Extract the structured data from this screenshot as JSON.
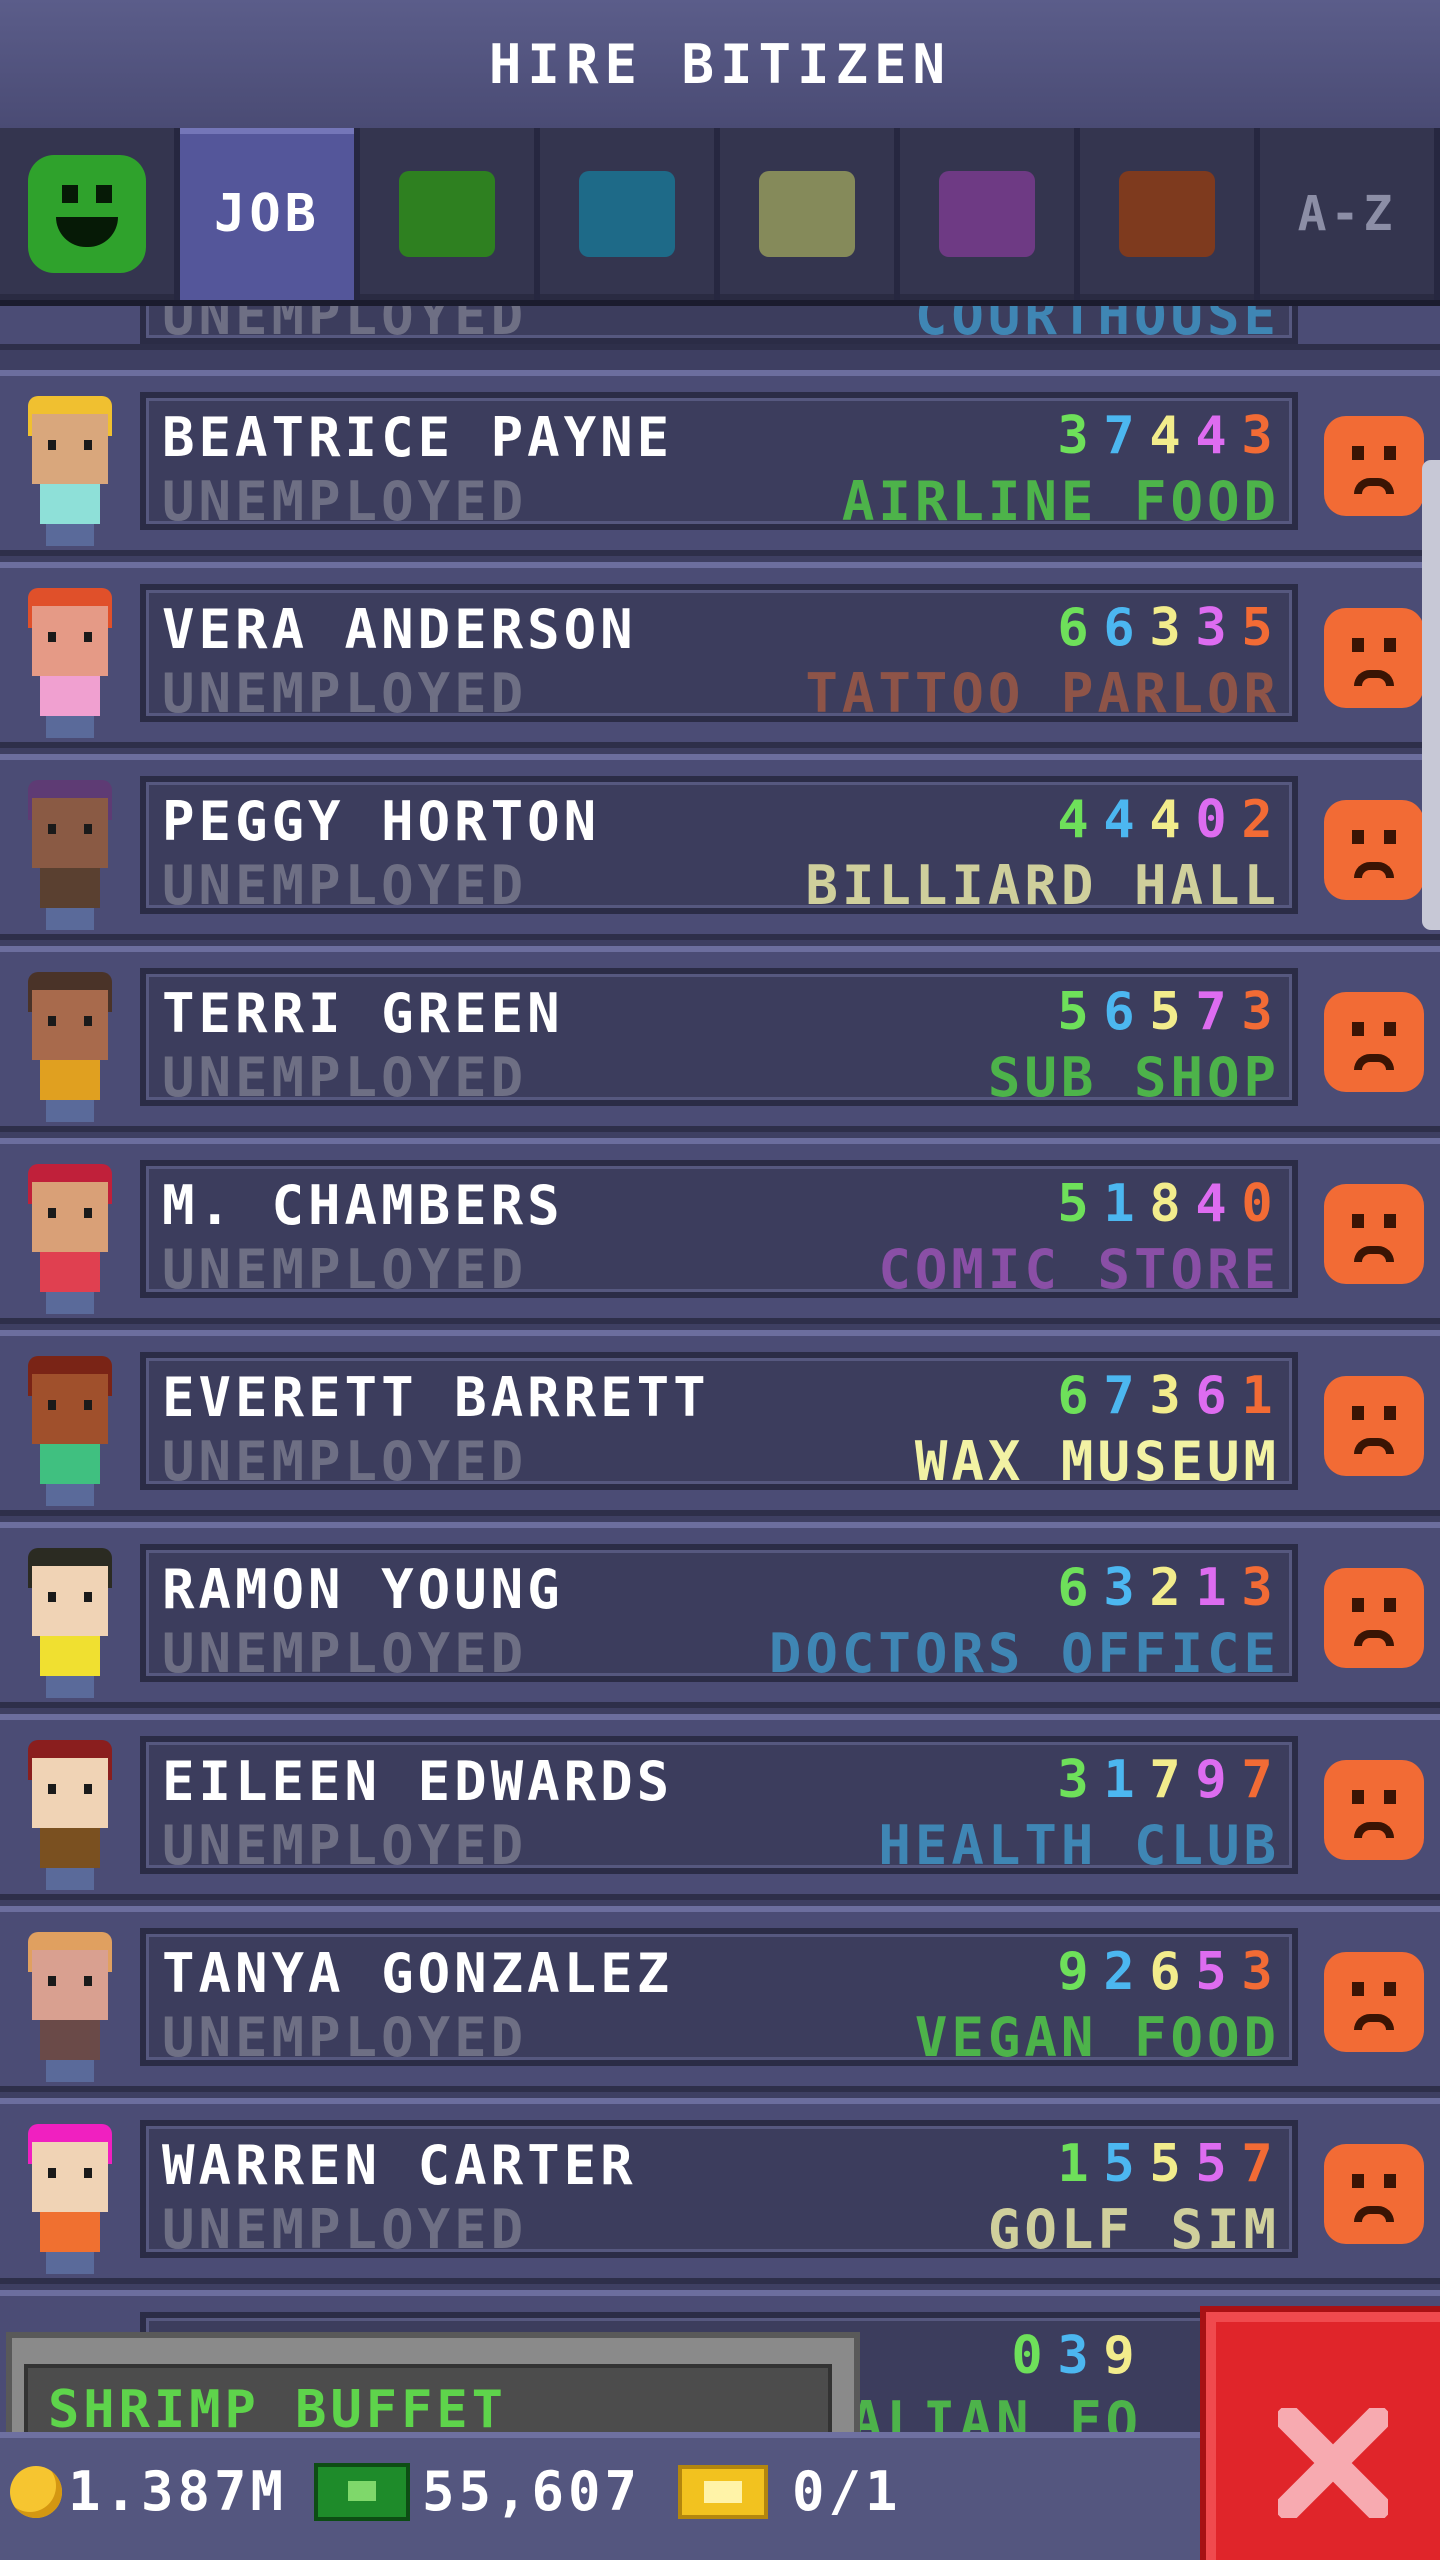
{
  "header": {
    "title": "HIRE BITIZEN"
  },
  "tabs": {
    "job_label": "JOB",
    "az_label": "A-Z",
    "swatches": [
      {
        "icon": "face-icon",
        "color": "#2fa22c"
      },
      {
        "color": "#2e8020"
      },
      {
        "color": "#1e6a88"
      },
      {
        "color": "#858a5a"
      },
      {
        "color": "#6e3a84"
      },
      {
        "color": "#7e3a1e"
      }
    ]
  },
  "partial_top_row": {
    "status": "UNEMPLOYED",
    "job": "COURTHOUSE"
  },
  "rows": [
    {
      "name": "BEATRICE PAYNE",
      "status": "UNEMPLOYED",
      "stats": [
        "3",
        "7",
        "4",
        "4",
        "3"
      ],
      "job": "AIRLINE FOOD",
      "job_color": "#4db34a"
    },
    {
      "name": "VERA ANDERSON",
      "status": "UNEMPLOYED",
      "stats": [
        "6",
        "6",
        "3",
        "3",
        "5"
      ],
      "job": "TATTOO PARLOR",
      "job_color": "#8e5448"
    },
    {
      "name": "PEGGY HORTON",
      "status": "UNEMPLOYED",
      "stats": [
        "4",
        "4",
        "4",
        "0",
        "2"
      ],
      "job": "BILLIARD HALL",
      "job_color": "#cfcf9c"
    },
    {
      "name": "TERRI GREEN",
      "status": "UNEMPLOYED",
      "stats": [
        "5",
        "6",
        "5",
        "7",
        "3"
      ],
      "job": "SUB SHOP",
      "job_color": "#4db34a"
    },
    {
      "name": "M. CHAMBERS",
      "status": "UNEMPLOYED",
      "stats": [
        "5",
        "1",
        "8",
        "4",
        "0"
      ],
      "job": "COMIC STORE",
      "job_color": "#8a4fa6"
    },
    {
      "name": "EVERETT BARRETT",
      "status": "UNEMPLOYED",
      "stats": [
        "6",
        "7",
        "3",
        "6",
        "1"
      ],
      "job": "WAX MUSEUM",
      "job_color": "#f2f2a4"
    },
    {
      "name": "RAMON YOUNG",
      "status": "UNEMPLOYED",
      "stats": [
        "6",
        "3",
        "2",
        "1",
        "3"
      ],
      "job": "DOCTORS OFFICE",
      "job_color": "#3f86b4"
    },
    {
      "name": "EILEEN EDWARDS",
      "status": "UNEMPLOYED",
      "stats": [
        "3",
        "1",
        "7",
        "9",
        "7"
      ],
      "job": "HEALTH CLUB",
      "job_color": "#3f86b4"
    },
    {
      "name": "TANYA GONZALEZ",
      "status": "UNEMPLOYED",
      "stats": [
        "9",
        "2",
        "6",
        "5",
        "3"
      ],
      "job": "VEGAN FOOD",
      "job_color": "#4db34a"
    },
    {
      "name": "WARREN CARTER",
      "status": "UNEMPLOYED",
      "stats": [
        "1",
        "5",
        "5",
        "5",
        "7"
      ],
      "job": "GOLF SIM",
      "job_color": "#cfcf9c"
    }
  ],
  "partial_bottom_row": {
    "stats": [
      "0",
      "3",
      "9"
    ],
    "job": "ITALIAN FO"
  },
  "stat_colors": [
    "#6ee05a",
    "#4cb7f0",
    "#f2ec8c",
    "#dd6cf0",
    "#f26b35"
  ],
  "toast": {
    "label": "SHRIMP BUFFET"
  },
  "footer": {
    "coins": "1.387M",
    "bux": "55,607",
    "tickets": "0/1"
  }
}
